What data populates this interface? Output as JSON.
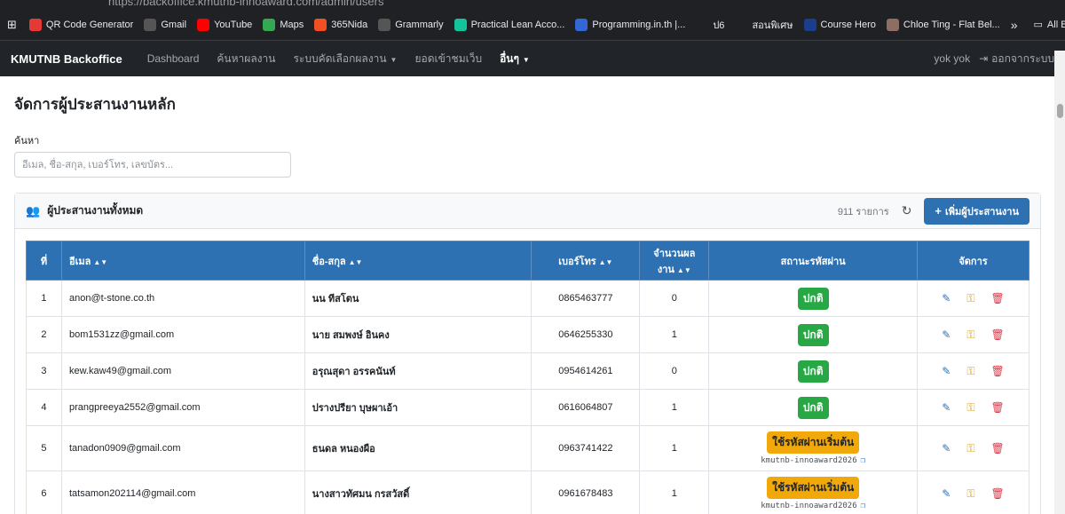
{
  "browser": {
    "url": "https://backoffice.kmutnb-innoaward.com/admin/users",
    "bookmarks": [
      {
        "label": "QR Code Generator",
        "color": "#e53935"
      },
      {
        "label": "Gmail",
        "color": "#555555"
      },
      {
        "label": "YouTube",
        "color": "#ff0000"
      },
      {
        "label": "Maps",
        "color": "#34a853"
      },
      {
        "label": "365Nida",
        "color": "#f25022"
      },
      {
        "label": "Grammarly",
        "color": "#555555"
      },
      {
        "label": "Practical Lean Acco...",
        "color": "#15c39a"
      },
      {
        "label": "Programming.in.th |...",
        "color": "#3367d6"
      },
      {
        "label": "ป6",
        "color": "#202124"
      },
      {
        "label": "สอนพิเศษ",
        "color": "#202124"
      },
      {
        "label": "Course Hero",
        "color": "#1a3e8c"
      },
      {
        "label": "Chloe Ting - Flat Bel...",
        "color": "#8d6e63"
      }
    ],
    "overflow": "»",
    "all_bookmarks": "All Bookmarks"
  },
  "nav": {
    "brand": "KMUTNB Backoffice",
    "items": [
      "Dashboard",
      "ค้นหาผลงาน",
      "ระบบคัดเลือกผลงาน",
      "ยอดเข้าชมเว็บ",
      "อื่นๆ"
    ],
    "user": "yok yok",
    "logout": "ออกจากระบบ"
  },
  "page": {
    "title": "จัดการผู้ประสานงานหลัก",
    "search_label": "ค้นหา",
    "search_placeholder": "อีเมล, ชื่อ-สกุล, เบอร์โทร, เลขบัตร..."
  },
  "card": {
    "title": "ผู้ประสานงานทั้งหมด",
    "count": "911 รายการ",
    "add_button": "เพิ่มผู้ประสานงาน"
  },
  "table": {
    "headers": [
      "ที่",
      "อีเมล",
      "ชื่อ-สกุล",
      "เบอร์โทร",
      "จำนวนผลงาน",
      "สถานะรหัสผ่าน",
      "จัดการ"
    ],
    "rows": [
      {
        "no": "1",
        "email": "anon@t-stone.co.th",
        "name": "นน ทีสโตน",
        "phone": "0865463777",
        "works": "0",
        "status": "ปกติ",
        "status_type": "ok",
        "default_pw": ""
      },
      {
        "no": "2",
        "email": "bom1531zz@gmail.com",
        "name": "นาย สมพงษ์ อินคง",
        "phone": "0646255330",
        "works": "1",
        "status": "ปกติ",
        "status_type": "ok",
        "default_pw": ""
      },
      {
        "no": "3",
        "email": "kew.kaw49@gmail.com",
        "name": "อรุณสุดา อรรคนันท์",
        "phone": "0954614261",
        "works": "0",
        "status": "ปกติ",
        "status_type": "ok",
        "default_pw": ""
      },
      {
        "no": "4",
        "email": "prangpreeya2552@gmail.com",
        "name": "ปรางปรียา บุษผาเอ้า",
        "phone": "0616064807",
        "works": "1",
        "status": "ปกติ",
        "status_type": "ok",
        "default_pw": ""
      },
      {
        "no": "5",
        "email": "tanadon0909@gmail.com",
        "name": "ธนดล หนองผือ",
        "phone": "0963741422",
        "works": "1",
        "status": "ใช้รหัสผ่านเริ่มต้น",
        "status_type": "warn",
        "default_pw": "kmutnb-innoaward2026"
      },
      {
        "no": "6",
        "email": "tatsamon202114@gmail.com",
        "name": "นางสาวทัศมน กรสวัสดิ์",
        "phone": "0961678483",
        "works": "1",
        "status": "ใช้รหัสผ่านเริ่มต้น",
        "status_type": "warn",
        "default_pw": "kmutnb-innoaward2026"
      }
    ]
  }
}
